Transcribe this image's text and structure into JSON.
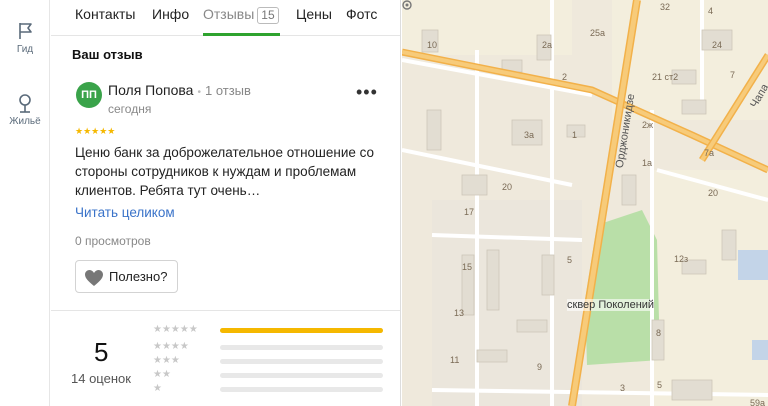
{
  "rail": {
    "guide_label": "Гид",
    "home_label": "Жильё"
  },
  "tabs": {
    "contacts": "Контакты",
    "info": "Инфо",
    "reviews": "Отзывы",
    "reviews_count": "15",
    "prices": "Цены",
    "photos": "Фотс"
  },
  "review": {
    "section_title": "Ваш отзыв",
    "avatar_initials": "ПП",
    "author": "Поля Попова",
    "author_reviews": "1 отзыв",
    "date": "сегодня",
    "more": "•••",
    "stars": "★★★★★",
    "rating": 5,
    "text": "Ценю банк за доброжелательное отношение со стороны сотрудников к нуждам и проблемам клиентов. Ребята тут очень…",
    "read_more": "Читать целиком",
    "views": "0 просмотров",
    "useful_label": "Полезно?"
  },
  "summary": {
    "rating_value": "5",
    "rating_count": "14 оценок",
    "histogram": [
      {
        "stars": "★★★★★",
        "fraction": 1.0
      },
      {
        "stars": "★★★★",
        "fraction": 0
      },
      {
        "stars": "★★★",
        "fraction": 0
      },
      {
        "stars": "★★",
        "fraction": 0
      },
      {
        "stars": "★",
        "fraction": 0
      }
    ]
  },
  "map": {
    "street_main": "Орджоникидзе",
    "street_right": "Чапа",
    "poi": "сквер Поколений",
    "house_numbers": [
      "32",
      "10",
      "2а",
      "25а",
      "2",
      "24",
      "4",
      "21 ст2",
      "7",
      "2ж",
      "1",
      "7а",
      "3а",
      "1а",
      "20",
      "20",
      "17",
      "12з",
      "15",
      "5",
      "13",
      "8",
      "11",
      "9",
      "3",
      "5",
      "59а"
    ]
  },
  "colors": {
    "accent_green": "#2ea32e",
    "link_blue": "#3a73c9",
    "star_yellow": "#f5b800",
    "avatar_green": "#3aa34a",
    "road_orange": "#f2b14a"
  }
}
